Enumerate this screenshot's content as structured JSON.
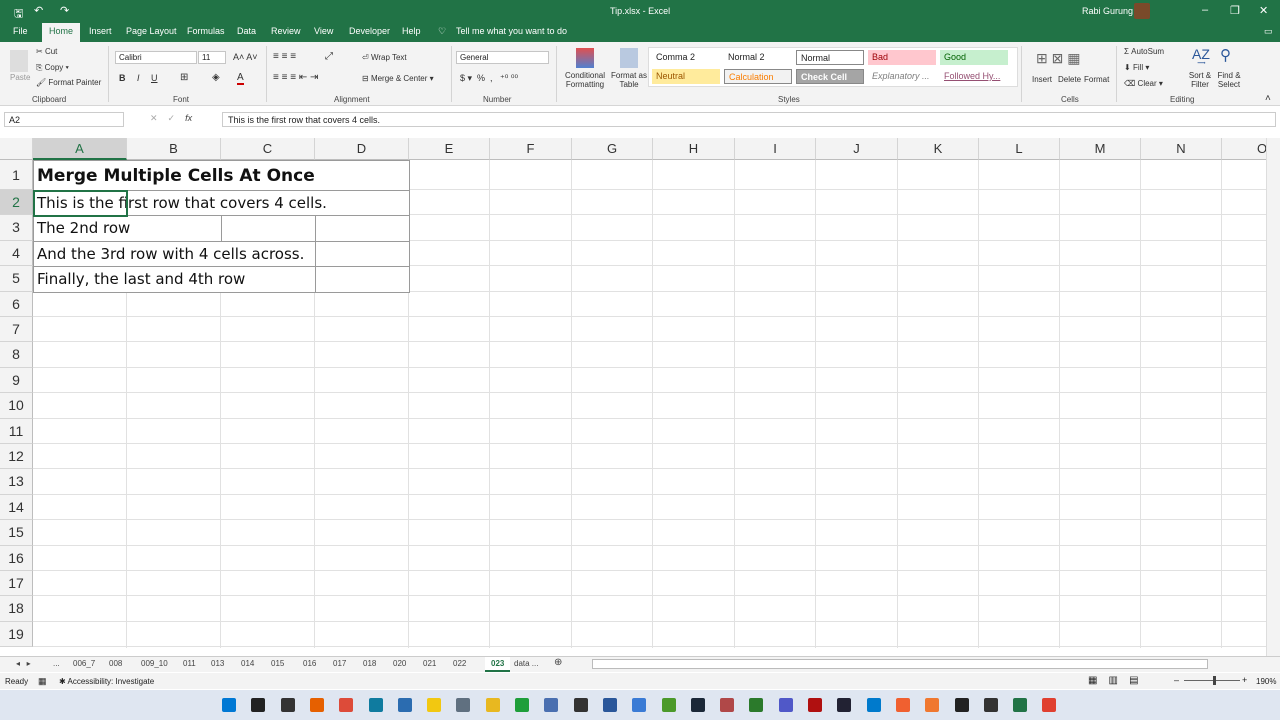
{
  "window": {
    "title": "Tip.xlsx - Excel",
    "user": "Rabi Gurung"
  },
  "menu": [
    "File",
    "Home",
    "Insert",
    "Page Layout",
    "Formulas",
    "Data",
    "Review",
    "View",
    "Developer",
    "Help"
  ],
  "tell_me": "Tell me what you want to do",
  "ribbon": {
    "clipboard": {
      "paste": "Paste",
      "cut": "Cut",
      "copy": "Copy",
      "format_painter": "Format Painter",
      "label": "Clipboard"
    },
    "font": {
      "name": "Calibri",
      "size": "11",
      "label": "Font"
    },
    "alignment": {
      "wrap": "Wrap Text",
      "merge": "Merge & Center",
      "label": "Alignment"
    },
    "number": {
      "format": "General",
      "label": "Number"
    },
    "styles": {
      "conditional": "Conditional Formatting",
      "format_table": "Format as Table",
      "label": "Styles",
      "cells": [
        {
          "name": "Comma 2",
          "bg": "#ffffff",
          "fg": "#222222"
        },
        {
          "name": "Normal 2",
          "bg": "#ffffff",
          "fg": "#222222"
        },
        {
          "name": "Normal",
          "bg": "#ffffff",
          "fg": "#222222"
        },
        {
          "name": "Bad",
          "bg": "#ffc7ce",
          "fg": "#9c0006"
        },
        {
          "name": "Good",
          "bg": "#c6efce",
          "fg": "#006100"
        },
        {
          "name": "Neutral",
          "bg": "#ffeb9c",
          "fg": "#9c5700"
        },
        {
          "name": "Calculation",
          "bg": "#f2f2f2",
          "fg": "#fa7d00"
        },
        {
          "name": "Check Cell",
          "bg": "#a5a5a5",
          "fg": "#ffffff"
        },
        {
          "name": "Explanatory ...",
          "bg": "#ffffff",
          "fg": "#7f7f7f"
        },
        {
          "name": "Followed Hy...",
          "bg": "#ffffff",
          "fg": "#954f72"
        }
      ]
    },
    "cells": {
      "insert": "Insert",
      "delete": "Delete",
      "format": "Format",
      "label": "Cells"
    },
    "editing": {
      "autosum": "AutoSum",
      "fill": "Fill",
      "clear": "Clear",
      "sort": "Sort & Filter",
      "find": "Find & Select",
      "label": "Editing"
    }
  },
  "formula_bar": {
    "name_box": "A2",
    "formula": "This is the first row that covers 4 cells."
  },
  "columns": [
    "A",
    "B",
    "C",
    "D",
    "E",
    "F",
    "G",
    "H",
    "I",
    "J",
    "K",
    "L",
    "M",
    "N",
    "O"
  ],
  "rows": [
    "1",
    "2",
    "3",
    "4",
    "5",
    "6",
    "7",
    "8",
    "9",
    "10",
    "11",
    "12",
    "13",
    "14",
    "15",
    "16",
    "17",
    "18",
    "19"
  ],
  "cells": {
    "r1": "Merge Multiple Cells At Once",
    "r2": "This is the first row that covers 4 cells.",
    "r3": "The 2nd row",
    "r4": "And the 3rd row with 4 cells across.",
    "r5": "Finally, the last and 4th row"
  },
  "sheet_tabs": [
    "...",
    "006_7",
    "008",
    "009_10",
    "011",
    "013",
    "014",
    "015",
    "016",
    "017",
    "018",
    "020",
    "021",
    "022",
    "023",
    "data ..."
  ],
  "active_tab": "023",
  "status": {
    "ready": "Ready",
    "accessibility": "Accessibility: Investigate",
    "zoom": "190%"
  },
  "accent": "#217346"
}
